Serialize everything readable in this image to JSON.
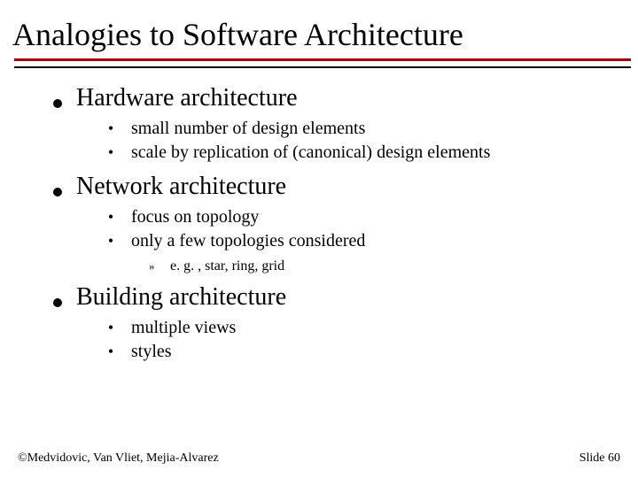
{
  "title": "Analogies to Software Architecture",
  "sections": [
    {
      "heading": "Hardware architecture",
      "points": [
        {
          "text": "small number of design elements"
        },
        {
          "text": "scale by replication of (canonical) design elements"
        }
      ]
    },
    {
      "heading": "Network architecture",
      "points": [
        {
          "text": "focus on topology"
        },
        {
          "text": "only a few topologies considered",
          "sub": [
            "e. g. , star, ring, grid"
          ]
        }
      ]
    },
    {
      "heading": "Building architecture",
      "points": [
        {
          "text": "multiple views"
        },
        {
          "text": "styles"
        }
      ]
    }
  ],
  "footer": {
    "left": "©Medvidovic, Van Vliet, Mejia-Alvarez",
    "right": "Slide 60"
  }
}
